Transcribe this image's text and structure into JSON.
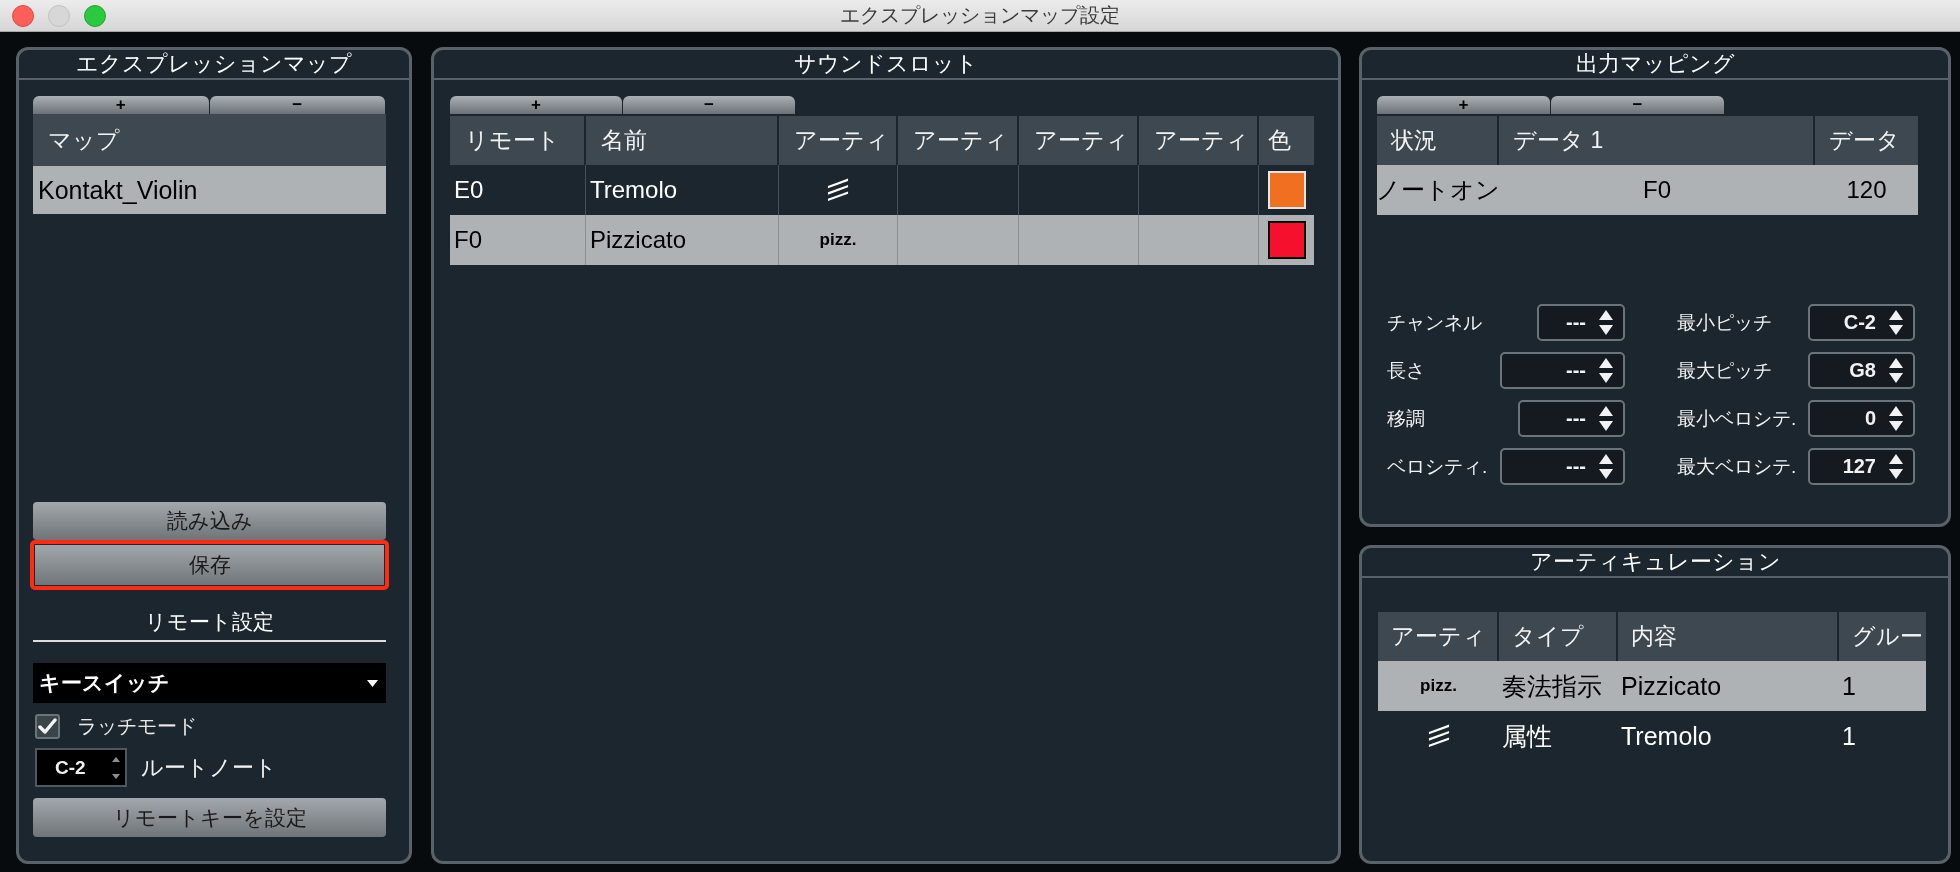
{
  "window": {
    "title": "エクスプレッションマップ設定"
  },
  "expression_maps": {
    "title": "エクスプレッションマップ",
    "add_button": "+",
    "remove_button": "−",
    "columns": [
      "マップ"
    ],
    "rows": [
      {
        "name": "Kontakt_Violin",
        "selected": true
      }
    ],
    "load_button": "読み込み",
    "save_button": {
      "label": "保存",
      "highlighted": true
    }
  },
  "remote_settings": {
    "title": "リモート設定",
    "mode": "キースイッチ",
    "latch_mode": {
      "label": "ラッチモード",
      "checked": true
    },
    "root_note": {
      "value": "C-2",
      "label": "ルートノート"
    },
    "set_remote_key_button": "リモートキーを設定"
  },
  "sound_slots": {
    "title": "サウンドスロット",
    "add_button": "+",
    "remove_button": "−",
    "columns": [
      "リモート",
      "名前",
      "アーティ",
      "アーティ",
      "アーティ",
      "アーティ",
      "色"
    ],
    "rows": [
      {
        "remote": "E0",
        "name": "Tremolo",
        "articulation": {
          "kind": "tremolo"
        },
        "color": "#f07022",
        "selected": false
      },
      {
        "remote": "F0",
        "name": "Pizzicato",
        "articulation": {
          "kind": "text",
          "text": "pizz."
        },
        "color": "#f5102e",
        "selected": true
      }
    ]
  },
  "output_mapping": {
    "title": "出力マッピング",
    "add_button": "+",
    "remove_button": "−",
    "columns": [
      "状況",
      "データ 1",
      "データ"
    ],
    "rows": [
      {
        "status": "ノートオン",
        "data_1": "F0",
        "data_2": "120",
        "selected": true
      }
    ],
    "fields": [
      {
        "label": "チャンネル",
        "value": "---"
      },
      {
        "label": "最小ピッチ",
        "value": "C-2"
      },
      {
        "label": "長さ",
        "value": "---"
      },
      {
        "label": "最大ピッチ",
        "value": "G8"
      },
      {
        "label": "移調",
        "value": "---"
      },
      {
        "label": "最小ベロシテ.",
        "value": "0"
      },
      {
        "label": "ベロシティ.",
        "value": "---"
      },
      {
        "label": "最大ベロシテ.",
        "value": "127"
      }
    ]
  },
  "articulations": {
    "title": "アーティキュレーション",
    "columns": [
      "アーティ",
      "タイプ",
      "内容",
      "グルー"
    ],
    "rows": [
      {
        "symbol": {
          "kind": "text",
          "text": "pizz."
        },
        "type": "奏法指示",
        "content": "Pizzicato",
        "group": "1",
        "selected": true
      },
      {
        "symbol": {
          "kind": "tremolo"
        },
        "type": "属性",
        "content": "Tremolo",
        "group": "1",
        "selected": false
      }
    ]
  }
}
